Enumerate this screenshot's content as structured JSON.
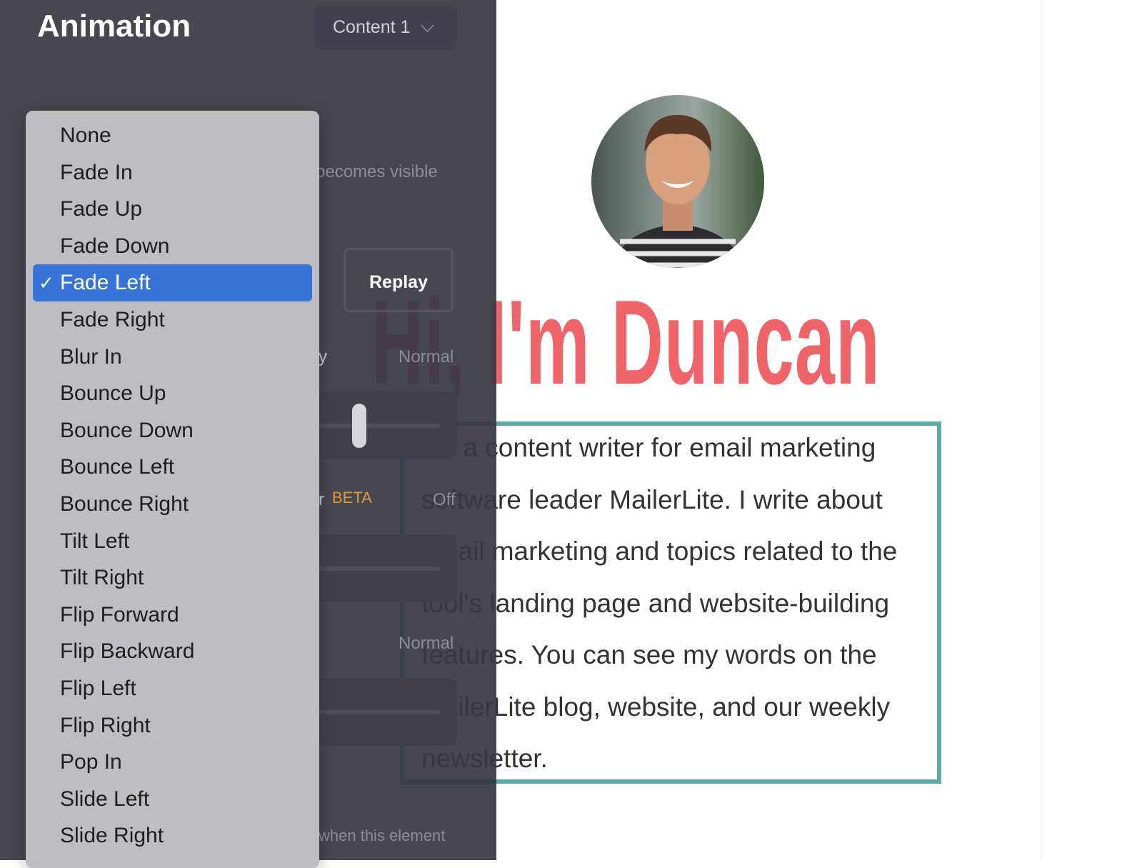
{
  "panel": {
    "title": "Animation",
    "content_select": "Content 1",
    "hint_visible": "becomes visible",
    "replay_label": "Replay",
    "intensity_fragment": "y",
    "intensity_value": "Normal",
    "beta_fragment": "r",
    "beta_badge": "BETA",
    "beta_value": "Off",
    "speed_value": "Normal",
    "footer_hint": "when this element",
    "slider_level": 0.2
  },
  "dropdown": {
    "selected": "Fade Left",
    "check": "✓",
    "options": [
      "None",
      "Fade In",
      "Fade Up",
      "Fade Down",
      "Fade Left",
      "Fade Right",
      "Blur In",
      "Bounce Up",
      "Bounce Down",
      "Bounce Left",
      "Bounce Right",
      "Tilt Left",
      "Tilt Right",
      "Flip Forward",
      "Flip Backward",
      "Flip Left",
      "Flip Right",
      "Pop In",
      "Slide Left",
      "Slide Right"
    ]
  },
  "page": {
    "heading": "Hi, I'm Duncan",
    "bio_lines": [
      "I'm a content writer for email marketing",
      "software leader MailerLite. I write about",
      "email marketing and topics related to the",
      "tool's landing page and website-building",
      "features. You can see my words on the",
      "MailerLite blog, website, and our weekly",
      "newsletter."
    ]
  },
  "colors": {
    "accent": "#3874d8",
    "heading": "#ee6468",
    "border": "#5aaba6",
    "beta": "#e09a3c"
  }
}
